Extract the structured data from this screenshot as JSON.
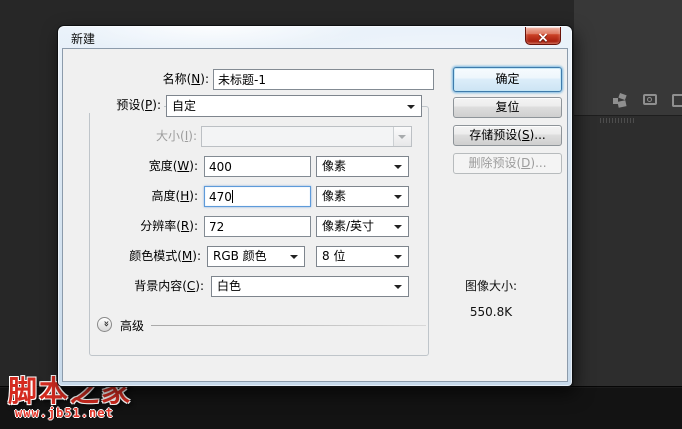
{
  "window": {
    "title": "新建"
  },
  "icons": {
    "close": "×",
    "advanced_chevron": "»"
  },
  "fields": {
    "name": {
      "label_pre": "名称(",
      "label_key": "N",
      "label_post": "):",
      "value": "未标题-1"
    },
    "preset": {
      "label_pre": "预设(",
      "label_key": "P",
      "label_post": "):",
      "value": "自定"
    },
    "size": {
      "label_pre": "大小(",
      "label_key": "I",
      "label_post": "):",
      "value": ""
    },
    "width": {
      "label_pre": "宽度(",
      "label_key": "W",
      "label_post": "):",
      "value": "400",
      "unit": "像素"
    },
    "height": {
      "label_pre": "高度(",
      "label_key": "H",
      "label_post": "):",
      "value": "470",
      "unit": "像素"
    },
    "resolution": {
      "label_pre": "分辨率(",
      "label_key": "R",
      "label_post": "):",
      "value": "72",
      "unit": "像素/英寸"
    },
    "color_mode": {
      "label_pre": "颜色模式(",
      "label_key": "M",
      "label_post": "):",
      "value": "RGB 颜色",
      "depth": "8 位"
    },
    "background_contents": {
      "label_pre": "背景内容(",
      "label_key": "C",
      "label_post": "):",
      "value": "白色"
    }
  },
  "buttons": {
    "ok": "确定",
    "reset": "复位",
    "save_preset_pre": "存储预设(",
    "save_preset_key": "S",
    "save_preset_post": ")...",
    "delete_preset_pre": "删除预设(",
    "delete_preset_key": "D",
    "delete_preset_post": ")..."
  },
  "advanced": {
    "label": "高级"
  },
  "image_size": {
    "label": "图像大小:",
    "value": "550.8K"
  },
  "watermark": {
    "title": "脚本之家",
    "url": "www.jb51.net"
  },
  "colors": {
    "dialog_bg": "#f0f0f0",
    "focus_blue": "#3f7bab",
    "close_red": "#c13f27",
    "ps_dark": "#272727"
  }
}
